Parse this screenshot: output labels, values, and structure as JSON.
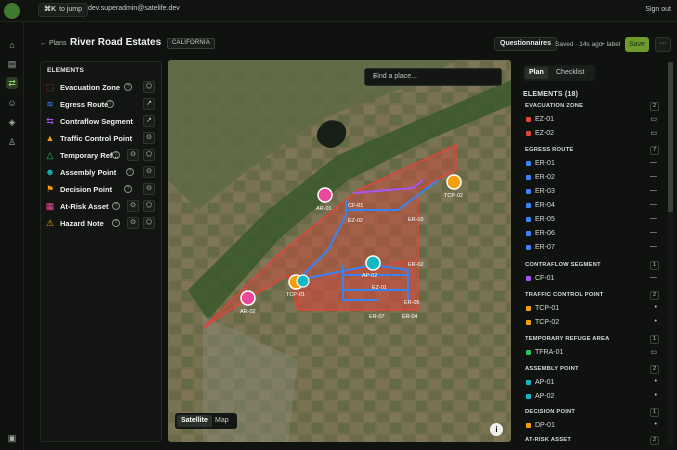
{
  "topbar": {
    "jump_key": "⌘K",
    "jump_label": "to jump",
    "email": "dev.superadmin@satelife.dev",
    "sign_out": "Sign out"
  },
  "header": {
    "back_label": "← Plans",
    "title": "River Road Estates",
    "state": "CALIFORNIA",
    "questionnaires": "Questionnaires",
    "saved": "Saved · 14s ago",
    "add_label": "+ label",
    "save": "Save",
    "more": "···"
  },
  "elements_panel": {
    "title": "ELEMENTS",
    "items": [
      {
        "label": "Evacuation Zone",
        "color": "#e0443a",
        "icon": "zone-icon"
      },
      {
        "label": "Egress Route",
        "color": "#3b82f6",
        "icon": "route-icon"
      },
      {
        "label": "Contraflow Segment",
        "color": "#a855f7",
        "icon": "contraflow-icon"
      },
      {
        "label": "Traffic Control Point",
        "color": "#f59e0b",
        "icon": "cone-icon"
      },
      {
        "label": "Temporary Ref...",
        "color": "#22c55e",
        "icon": "refuge-icon"
      },
      {
        "label": "Assembly Point",
        "color": "#14b8c4",
        "icon": "people-icon"
      },
      {
        "label": "Decision Point",
        "color": "#f59e0b",
        "icon": "signpost-icon"
      },
      {
        "label": "At-Risk Asset",
        "color": "#ec4899",
        "icon": "building-icon"
      },
      {
        "label": "Hazard Note",
        "color": "#eab308",
        "icon": "warning-icon"
      }
    ]
  },
  "map": {
    "search_placeholder": "Find a place...",
    "toggle": [
      "Satellite",
      "Map"
    ],
    "info": "i",
    "labels": {
      "cf01": "CF-01",
      "ar01": "AR-01",
      "ez02": "EZ-02",
      "er03": "ER-03",
      "tcp02": "TCP-02",
      "ap02": "AP-02",
      "er02": "ER-02",
      "ez01": "EZ-01",
      "tcp01": "TCP-01",
      "ar02": "AR-02",
      "er05": "ER-05",
      "er07": "ER-07",
      "er04": "ER-04"
    }
  },
  "right_panel": {
    "tabs": [
      "Plan",
      "Checklist"
    ],
    "count_label": "ELEMENTS (18)",
    "groups": [
      {
        "title": "EVACUATION ZONE",
        "count": "2",
        "items": [
          {
            "label": "EZ-01",
            "color": "#e0443a",
            "glyph": "▭"
          },
          {
            "label": "EZ-02",
            "color": "#e0443a",
            "glyph": "▭"
          }
        ]
      },
      {
        "title": "EGRESS ROUTE",
        "count": "7",
        "items": [
          {
            "label": "ER-01",
            "color": "#3b82f6",
            "glyph": "—"
          },
          {
            "label": "ER-02",
            "color": "#3b82f6",
            "glyph": "—"
          },
          {
            "label": "ER-03",
            "color": "#3b82f6",
            "glyph": "—"
          },
          {
            "label": "ER-04",
            "color": "#3b82f6",
            "glyph": "—"
          },
          {
            "label": "ER-05",
            "color": "#3b82f6",
            "glyph": "—"
          },
          {
            "label": "ER-06",
            "color": "#3b82f6",
            "glyph": "—"
          },
          {
            "label": "ER-07",
            "color": "#3b82f6",
            "glyph": "—"
          }
        ]
      },
      {
        "title": "CONTRAFLOW SEGMENT",
        "count": "1",
        "items": [
          {
            "label": "CF-01",
            "color": "#a855f7",
            "glyph": "—"
          }
        ]
      },
      {
        "title": "TRAFFIC CONTROL POINT",
        "count": "2",
        "items": [
          {
            "label": "TCP-01",
            "color": "#f59e0b",
            "glyph": "•"
          },
          {
            "label": "TCP-02",
            "color": "#f59e0b",
            "glyph": "•"
          }
        ]
      },
      {
        "title": "TEMPORARY REFUGE AREA",
        "count": "1",
        "items": [
          {
            "label": "TFRA-01",
            "color": "#22c55e",
            "glyph": "▭"
          }
        ]
      },
      {
        "title": "ASSEMBLY POINT",
        "count": "2",
        "items": [
          {
            "label": "AP-01",
            "color": "#14b8c4",
            "glyph": "•"
          },
          {
            "label": "AP-02",
            "color": "#14b8c4",
            "glyph": "•"
          }
        ]
      },
      {
        "title": "DECISION POINT",
        "count": "1",
        "items": [
          {
            "label": "DP-01",
            "color": "#f59e0b",
            "glyph": "•"
          }
        ]
      },
      {
        "title": "AT-RISK ASSET",
        "count": "2",
        "items": []
      }
    ]
  }
}
